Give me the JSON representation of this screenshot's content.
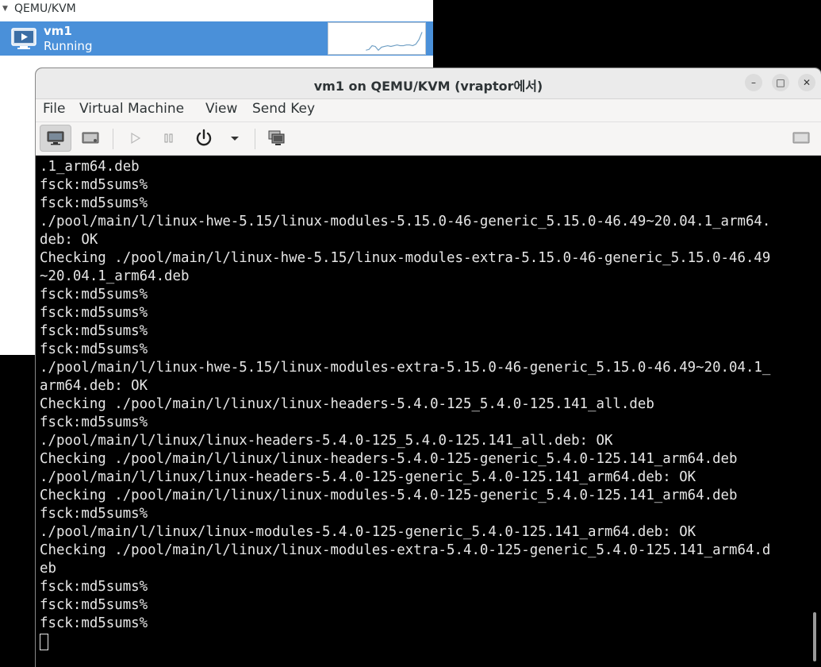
{
  "manager": {
    "group_label": "QEMU/KVM",
    "vm": {
      "name": "vm1",
      "state": "Running"
    }
  },
  "window": {
    "title": "vm1 on QEMU/KVM (vraptor에서)",
    "minimize_symbol": "–",
    "maximize_symbol": "□",
    "close_symbol": "✕"
  },
  "menu": {
    "file": "File",
    "virtual_machine": "Virtual Machine",
    "view": "View",
    "send_key": "Send Key"
  },
  "toolbar": {
    "icons": [
      "console-icon",
      "details-icon",
      "run-icon",
      "pause-icon",
      "power-icon",
      "dropdown-arrow-icon",
      "snapshots-icon",
      "fullscreen-icon"
    ]
  },
  "terminal": {
    "lines": [
      ".1_arm64.deb",
      "fsck:md5sums%",
      "fsck:md5sums%",
      "./pool/main/l/linux-hwe-5.15/linux-modules-5.15.0-46-generic_5.15.0-46.49~20.04.1_arm64.",
      "deb: OK",
      "Checking ./pool/main/l/linux-hwe-5.15/linux-modules-extra-5.15.0-46-generic_5.15.0-46.49",
      "~20.04.1_arm64.deb",
      "fsck:md5sums%",
      "fsck:md5sums%",
      "fsck:md5sums%",
      "fsck:md5sums%",
      "./pool/main/l/linux-hwe-5.15/linux-modules-extra-5.15.0-46-generic_5.15.0-46.49~20.04.1_",
      "arm64.deb: OK",
      "Checking ./pool/main/l/linux/linux-headers-5.4.0-125_5.4.0-125.141_all.deb",
      "fsck:md5sums%",
      "./pool/main/l/linux/linux-headers-5.4.0-125_5.4.0-125.141_all.deb: OK",
      "Checking ./pool/main/l/linux/linux-headers-5.4.0-125-generic_5.4.0-125.141_arm64.deb",
      "./pool/main/l/linux/linux-headers-5.4.0-125-generic_5.4.0-125.141_arm64.deb: OK",
      "Checking ./pool/main/l/linux/linux-modules-5.4.0-125-generic_5.4.0-125.141_arm64.deb",
      "fsck:md5sums%",
      "./pool/main/l/linux/linux-modules-5.4.0-125-generic_5.4.0-125.141_arm64.deb: OK",
      "Checking ./pool/main/l/linux/linux-modules-extra-5.4.0-125-generic_5.4.0-125.141_arm64.d",
      "eb",
      "fsck:md5sums%",
      "fsck:md5sums%",
      "fsck:md5sums%"
    ]
  },
  "colors": {
    "selection": "#4a90d9",
    "terminal_bg": "#000000",
    "terminal_fg": "#e6e6e6",
    "cpu_graph_line": "#6f9fc4"
  }
}
